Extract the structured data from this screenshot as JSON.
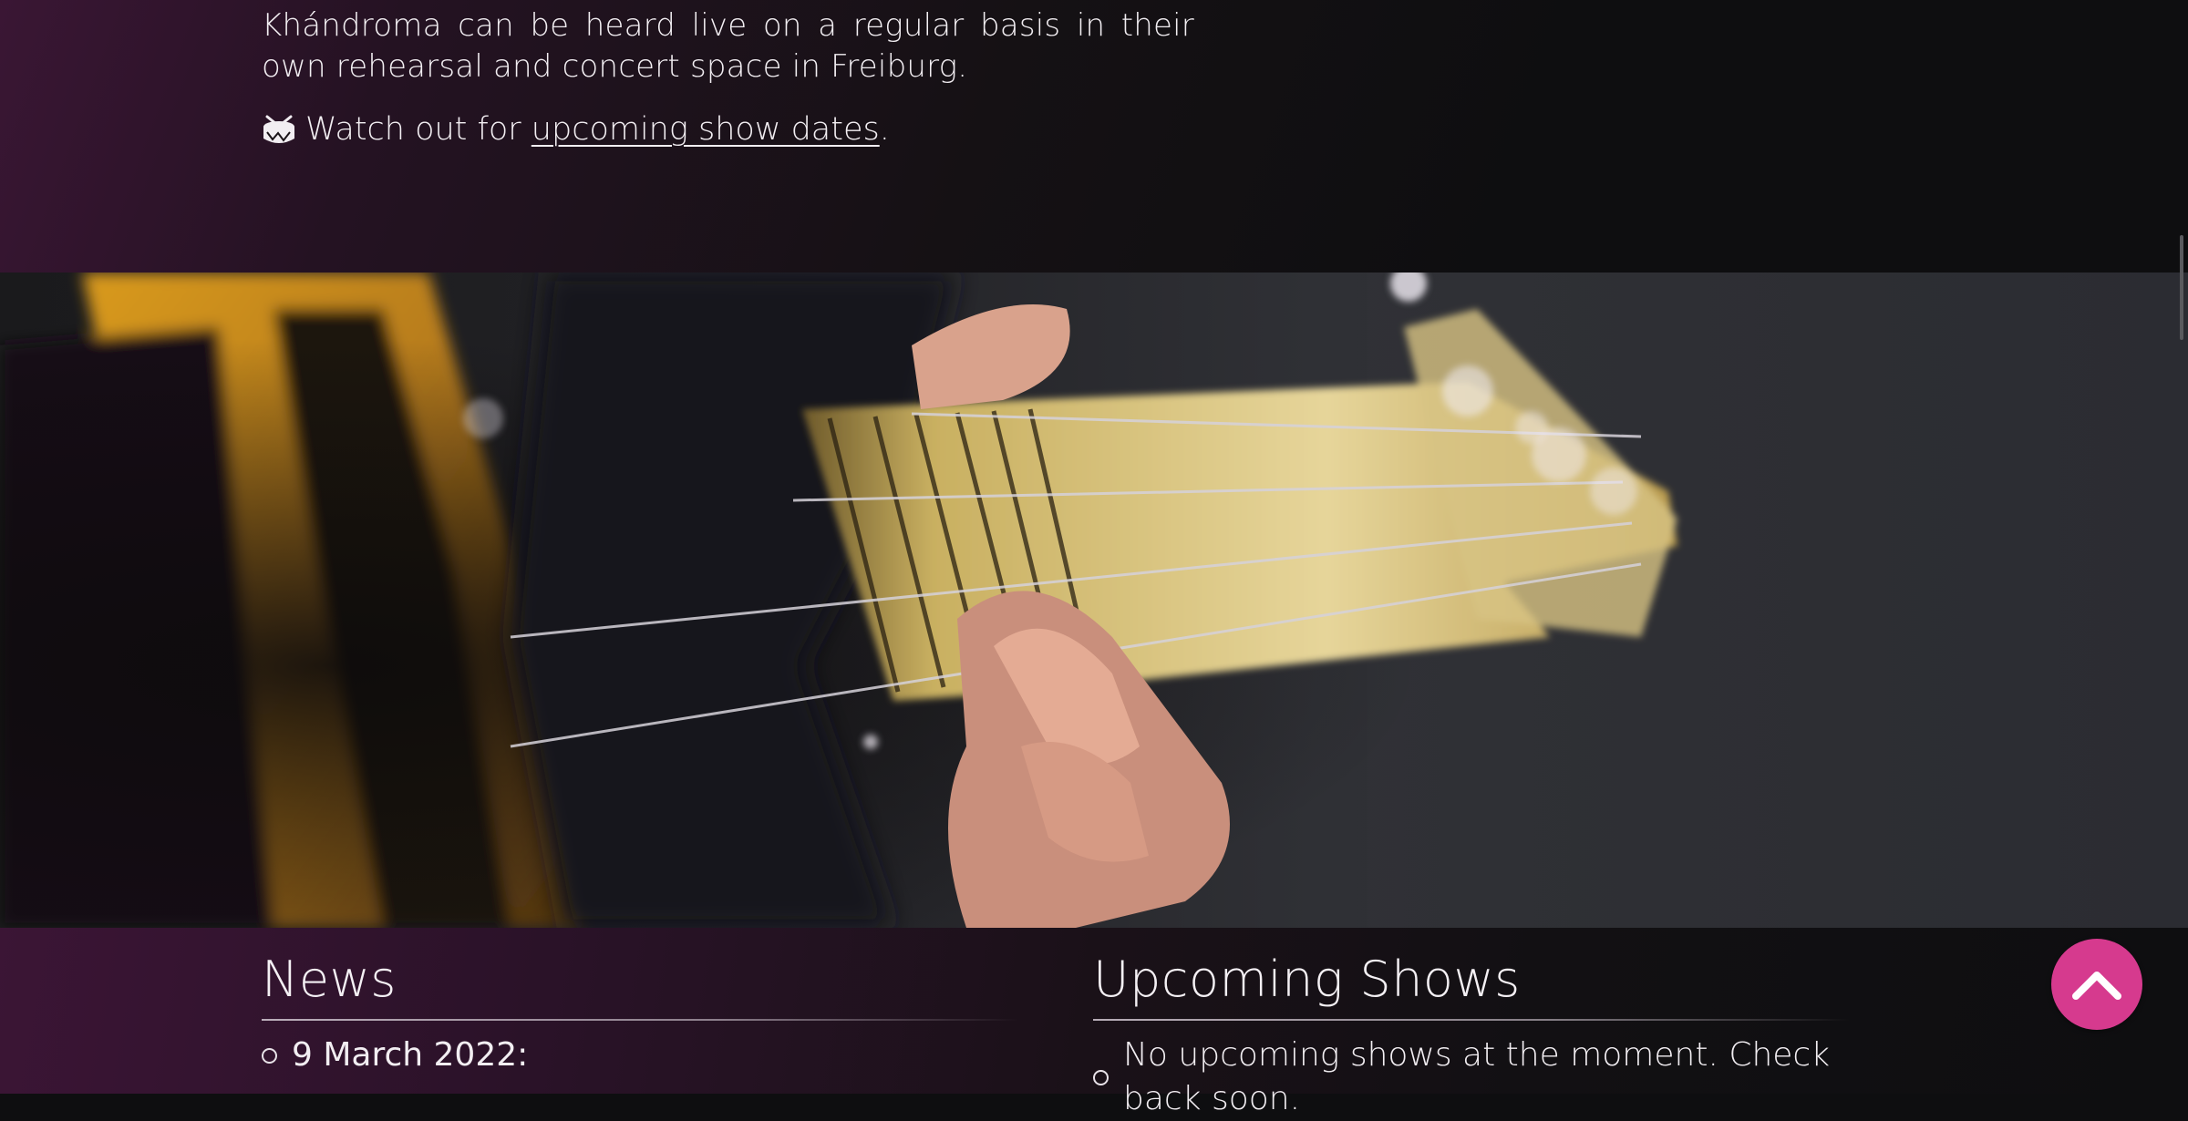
{
  "intro": {
    "paragraph": "Khándroma can be heard live on a regular basis in their own rehearsal and concert space in Freiburg.",
    "watch_prefix": "Watch out for ",
    "watch_link": "upcoming show dates",
    "watch_suffix": "."
  },
  "hero": {
    "image_alt": "Bass guitar"
  },
  "news": {
    "heading": "News",
    "items": [
      {
        "date": "9 March 2022:"
      }
    ]
  },
  "shows": {
    "heading": "Upcoming Shows",
    "items": [
      {
        "text": "No upcoming shows at the moment. Check back soon."
      }
    ]
  },
  "icons": {
    "drum": "drum-icon",
    "scroll_top": "chevron-up-icon"
  },
  "colors": {
    "accent": "#d63a8e",
    "background": "#0e0e10",
    "gradient_purple": "#3a1634",
    "text": "#f2eef2"
  }
}
